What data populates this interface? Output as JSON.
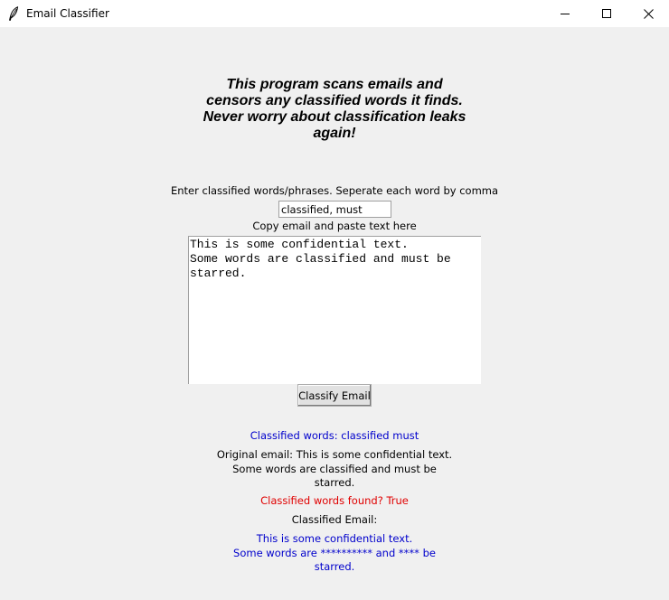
{
  "window": {
    "title": "Email Classifier",
    "icon": "feather-icon"
  },
  "headline": "This program scans emails and\ncensors any classified words it finds.\nNever worry about classification leaks\nagain!",
  "form": {
    "words_label": "Enter classified words/phrases. Seperate each word by comma",
    "words_value": "classified, must",
    "paste_label": "Copy email and paste text here",
    "email_text": "This is some confidential text.\nSome words are classified and must be\nstarred.",
    "classify_button": "Classify Email"
  },
  "results": {
    "classified_words": "Classified words: classified must",
    "original_email": "Original email: This is some confidential text.\nSome words are classified and must be\nstarred.",
    "found": "Classified words found? True",
    "classified_heading": "Classified Email:",
    "censored_email": "This is some confidential text.\nSome words are ********** and **** be\nstarred."
  },
  "colors": {
    "info_text": "#0000cc",
    "alert_text": "#e00000",
    "background": "#f0f0f0"
  }
}
